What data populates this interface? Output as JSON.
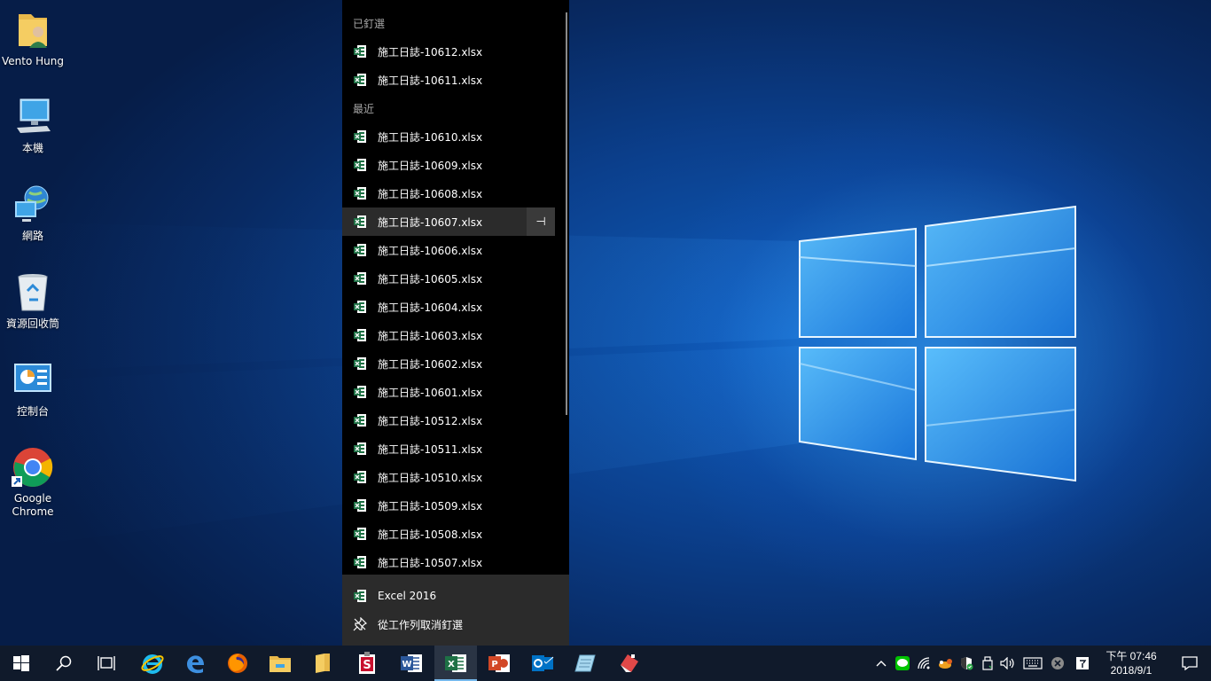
{
  "desktop": {
    "icons": [
      {
        "label": "Vento Hung",
        "icon": "user-folder-icon"
      },
      {
        "label": "本機",
        "icon": "this-pc-icon"
      },
      {
        "label": "網路",
        "icon": "network-icon"
      },
      {
        "label": "資源回收筒",
        "icon": "recycle-bin-icon"
      },
      {
        "label": "控制台",
        "icon": "control-panel-icon"
      },
      {
        "label": "Google Chrome",
        "icon": "chrome-icon"
      }
    ]
  },
  "jumplist": {
    "pinned_header": "已釘選",
    "pinned": [
      "施工日誌-10612.xlsx",
      "施工日誌-10611.xlsx"
    ],
    "recent_header": "最近",
    "recent": [
      "施工日誌-10610.xlsx",
      "施工日誌-10609.xlsx",
      "施工日誌-10608.xlsx",
      "施工日誌-10607.xlsx",
      "施工日誌-10606.xlsx",
      "施工日誌-10605.xlsx",
      "施工日誌-10604.xlsx",
      "施工日誌-10603.xlsx",
      "施工日誌-10602.xlsx",
      "施工日誌-10601.xlsx",
      "施工日誌-10512.xlsx",
      "施工日誌-10511.xlsx",
      "施工日誌-10510.xlsx",
      "施工日誌-10509.xlsx",
      "施工日誌-10508.xlsx",
      "施工日誌-10507.xlsx"
    ],
    "pin_glyph": "⊣",
    "app_name": "Excel 2016",
    "unpin_label": "從工作列取消釘選"
  },
  "taskbar": {
    "apps": [
      "start-icon",
      "search-icon",
      "task-view-icon",
      "internet-explorer-icon",
      "edge-icon",
      "firefox-icon",
      "file-explorer-icon",
      "folder-icon",
      "sticky-s-icon",
      "word-icon",
      "excel-icon",
      "powerpoint-icon",
      "outlook-icon",
      "notepad-icon",
      "eraser-app-icon"
    ],
    "tray": [
      "chevron-up-icon",
      "line-icon",
      "wifi-icon",
      "cloud-icon",
      "shield-icon",
      "usb-icon",
      "volume-icon",
      "keyboard-icon",
      "close-circle-icon",
      "ime-icon"
    ],
    "clock_period": "下午 07:46",
    "clock_date": "2018/9/1"
  },
  "colors": {
    "excel_green": "#1e7145",
    "word_blue": "#2b579a",
    "ppt_red": "#d24726",
    "outlook_blue": "#0072c6",
    "taskbar_bg": "#101a2b",
    "accent": "#76b9ed"
  }
}
